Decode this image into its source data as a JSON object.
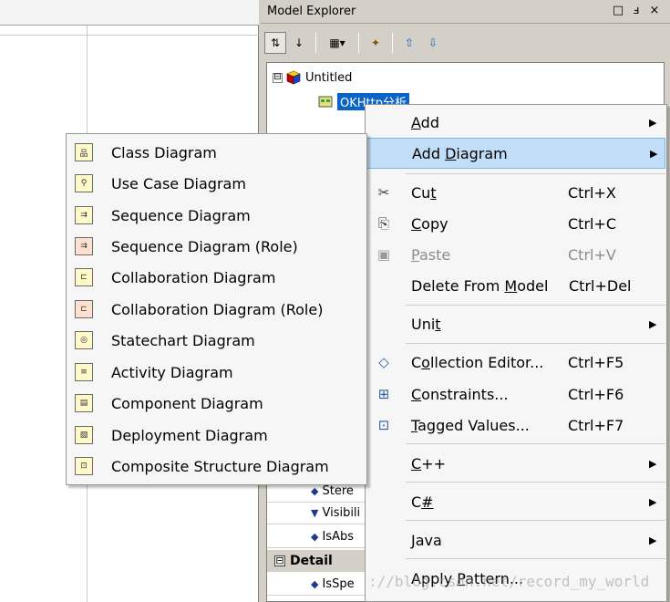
{
  "panel": {
    "title": "Model Explorer",
    "window_buttons": [
      "□",
      "ⅎ",
      "×"
    ]
  },
  "toolbar": {
    "buttons": [
      "sort-order-icon",
      "sort-alpha-icon",
      "add-element-icon",
      "filter-icon",
      "move-up-icon",
      "move-down-icon"
    ],
    "glyphs": [
      "⇅",
      "↓",
      "▦▾",
      "✦",
      "⇧",
      "⇩"
    ]
  },
  "tree": {
    "root_expander": "⊟",
    "root_label": "Untitled",
    "child_label": "OKHttp分析"
  },
  "props": {
    "rows": [
      {
        "label": "Stere"
      },
      {
        "label": "Visibili"
      },
      {
        "label": "IsAbs"
      }
    ],
    "section_expander": "⊟",
    "section_label": "Detail",
    "detail_row": "IsSpe"
  },
  "context_menu": {
    "items": [
      {
        "label": "Add",
        "u": "A",
        "shortcut": "",
        "submenu": true
      },
      {
        "label": "Add Diagram",
        "u": "D",
        "shortcut": "",
        "submenu": true
      },
      {
        "label": "Cut",
        "u": "t",
        "shortcut": "Ctrl+X",
        "submenu": false
      },
      {
        "label": "Copy",
        "u": "C",
        "shortcut": "Ctrl+C",
        "submenu": false
      },
      {
        "label": "Paste",
        "u": "P",
        "shortcut": "Ctrl+V",
        "submenu": false
      },
      {
        "label": "Delete From Model",
        "u": "M",
        "shortcut": "Ctrl+Del",
        "submenu": false
      },
      {
        "label": "Unit",
        "u": "t",
        "shortcut": "",
        "submenu": true
      },
      {
        "label": "Collection Editor...",
        "u": "o",
        "shortcut": "Ctrl+F5",
        "submenu": false
      },
      {
        "label": "Constraints...",
        "u": "C",
        "shortcut": "Ctrl+F6",
        "submenu": false
      },
      {
        "label": "Tagged Values...",
        "u": "T",
        "shortcut": "Ctrl+F7",
        "submenu": false
      },
      {
        "label": "C++",
        "u": "C",
        "shortcut": "",
        "submenu": true
      },
      {
        "label": "C#",
        "u": "#",
        "shortcut": "",
        "submenu": true
      },
      {
        "label": "Java",
        "u": "J",
        "shortcut": "",
        "submenu": true
      },
      {
        "label": "Apply Pattern...",
        "u": "P",
        "shortcut": "",
        "submenu": false
      }
    ],
    "arrow": "▶",
    "icons": {
      "cut": "✂",
      "copy": "⎘",
      "paste": "▣",
      "collection": "◇",
      "constraints": "⊞",
      "tagged": "⊡"
    }
  },
  "submenu": {
    "items": [
      {
        "label": "Class Diagram",
        "glyph": "品"
      },
      {
        "label": "Use Case Diagram",
        "glyph": "⚲"
      },
      {
        "label": "Sequence Diagram",
        "glyph": "⇉"
      },
      {
        "label": "Sequence Diagram (Role)",
        "glyph": "⇉"
      },
      {
        "label": "Collaboration Diagram",
        "glyph": "⊏"
      },
      {
        "label": "Collaboration Diagram (Role)",
        "glyph": "⊏"
      },
      {
        "label": "Statechart Diagram",
        "glyph": "◎"
      },
      {
        "label": "Activity Diagram",
        "glyph": "≡"
      },
      {
        "label": "Component Diagram",
        "glyph": "▤"
      },
      {
        "label": "Deployment Diagram",
        "glyph": "▧"
      },
      {
        "label": "Composite Structure Diagram",
        "glyph": "⊡"
      }
    ]
  },
  "watermark": "://blog.csdn.net/record_my_world"
}
